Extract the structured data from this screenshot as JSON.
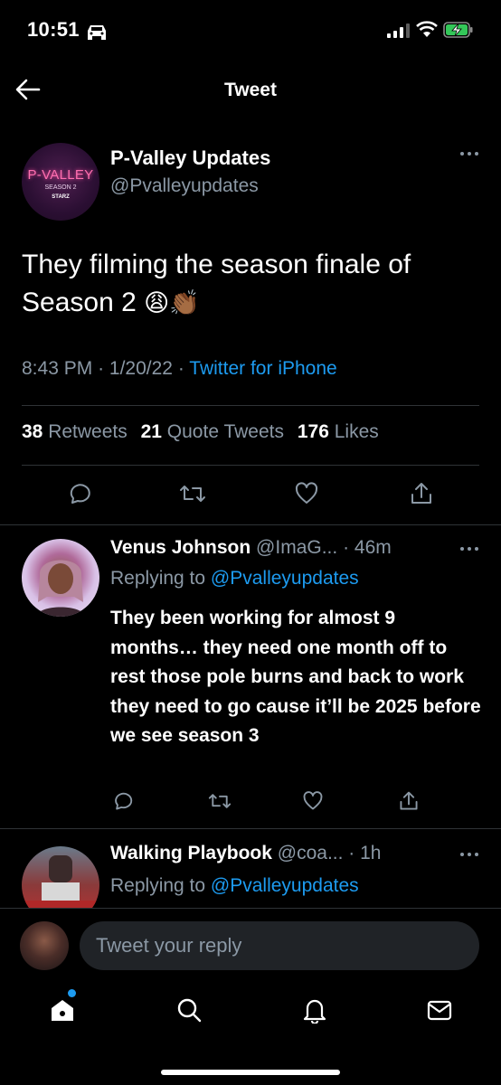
{
  "status_bar": {
    "time": "10:51"
  },
  "header": {
    "title": "Tweet"
  },
  "tweet": {
    "author_name": "P-Valley Updates",
    "author_handle": "@Pvalleyupdates",
    "avatar_text": {
      "title": "P-VALLEY",
      "season": "SEASON 2",
      "network": "STARZ"
    },
    "text_line1": "They filming the season finale of",
    "text_line2": "Season 2",
    "emojis": "😩👏🏾",
    "time": "8:43 PM",
    "date": "1/20/22",
    "separator": "·",
    "source": "Twitter for iPhone",
    "stats": {
      "retweets_count": "38",
      "retweets_label": "Retweets",
      "quotes_count": "21",
      "quotes_label": "Quote Tweets",
      "likes_count": "176",
      "likes_label": "Likes"
    }
  },
  "replies": [
    {
      "name": "Venus Johnson",
      "handle": "@ImaG...",
      "time": "· 46m",
      "replying_prefix": "Replying to",
      "replying_to": "@Pvalleyupdates",
      "text": "They been working for almost 9 months… they need one month off to rest those pole burns and back to work they need to go cause it’ll be 2025 before we see season 3"
    },
    {
      "name": "Walking Playbook",
      "handle": "@coa...",
      "time": "· 1h",
      "replying_prefix": "Replying to",
      "replying_to": "@Pvalleyupdates"
    }
  ],
  "composer": {
    "placeholder": "Tweet your reply"
  },
  "colors": {
    "accent": "#1d9bf0",
    "secondary_text": "#8b98a5",
    "background": "#000000"
  }
}
